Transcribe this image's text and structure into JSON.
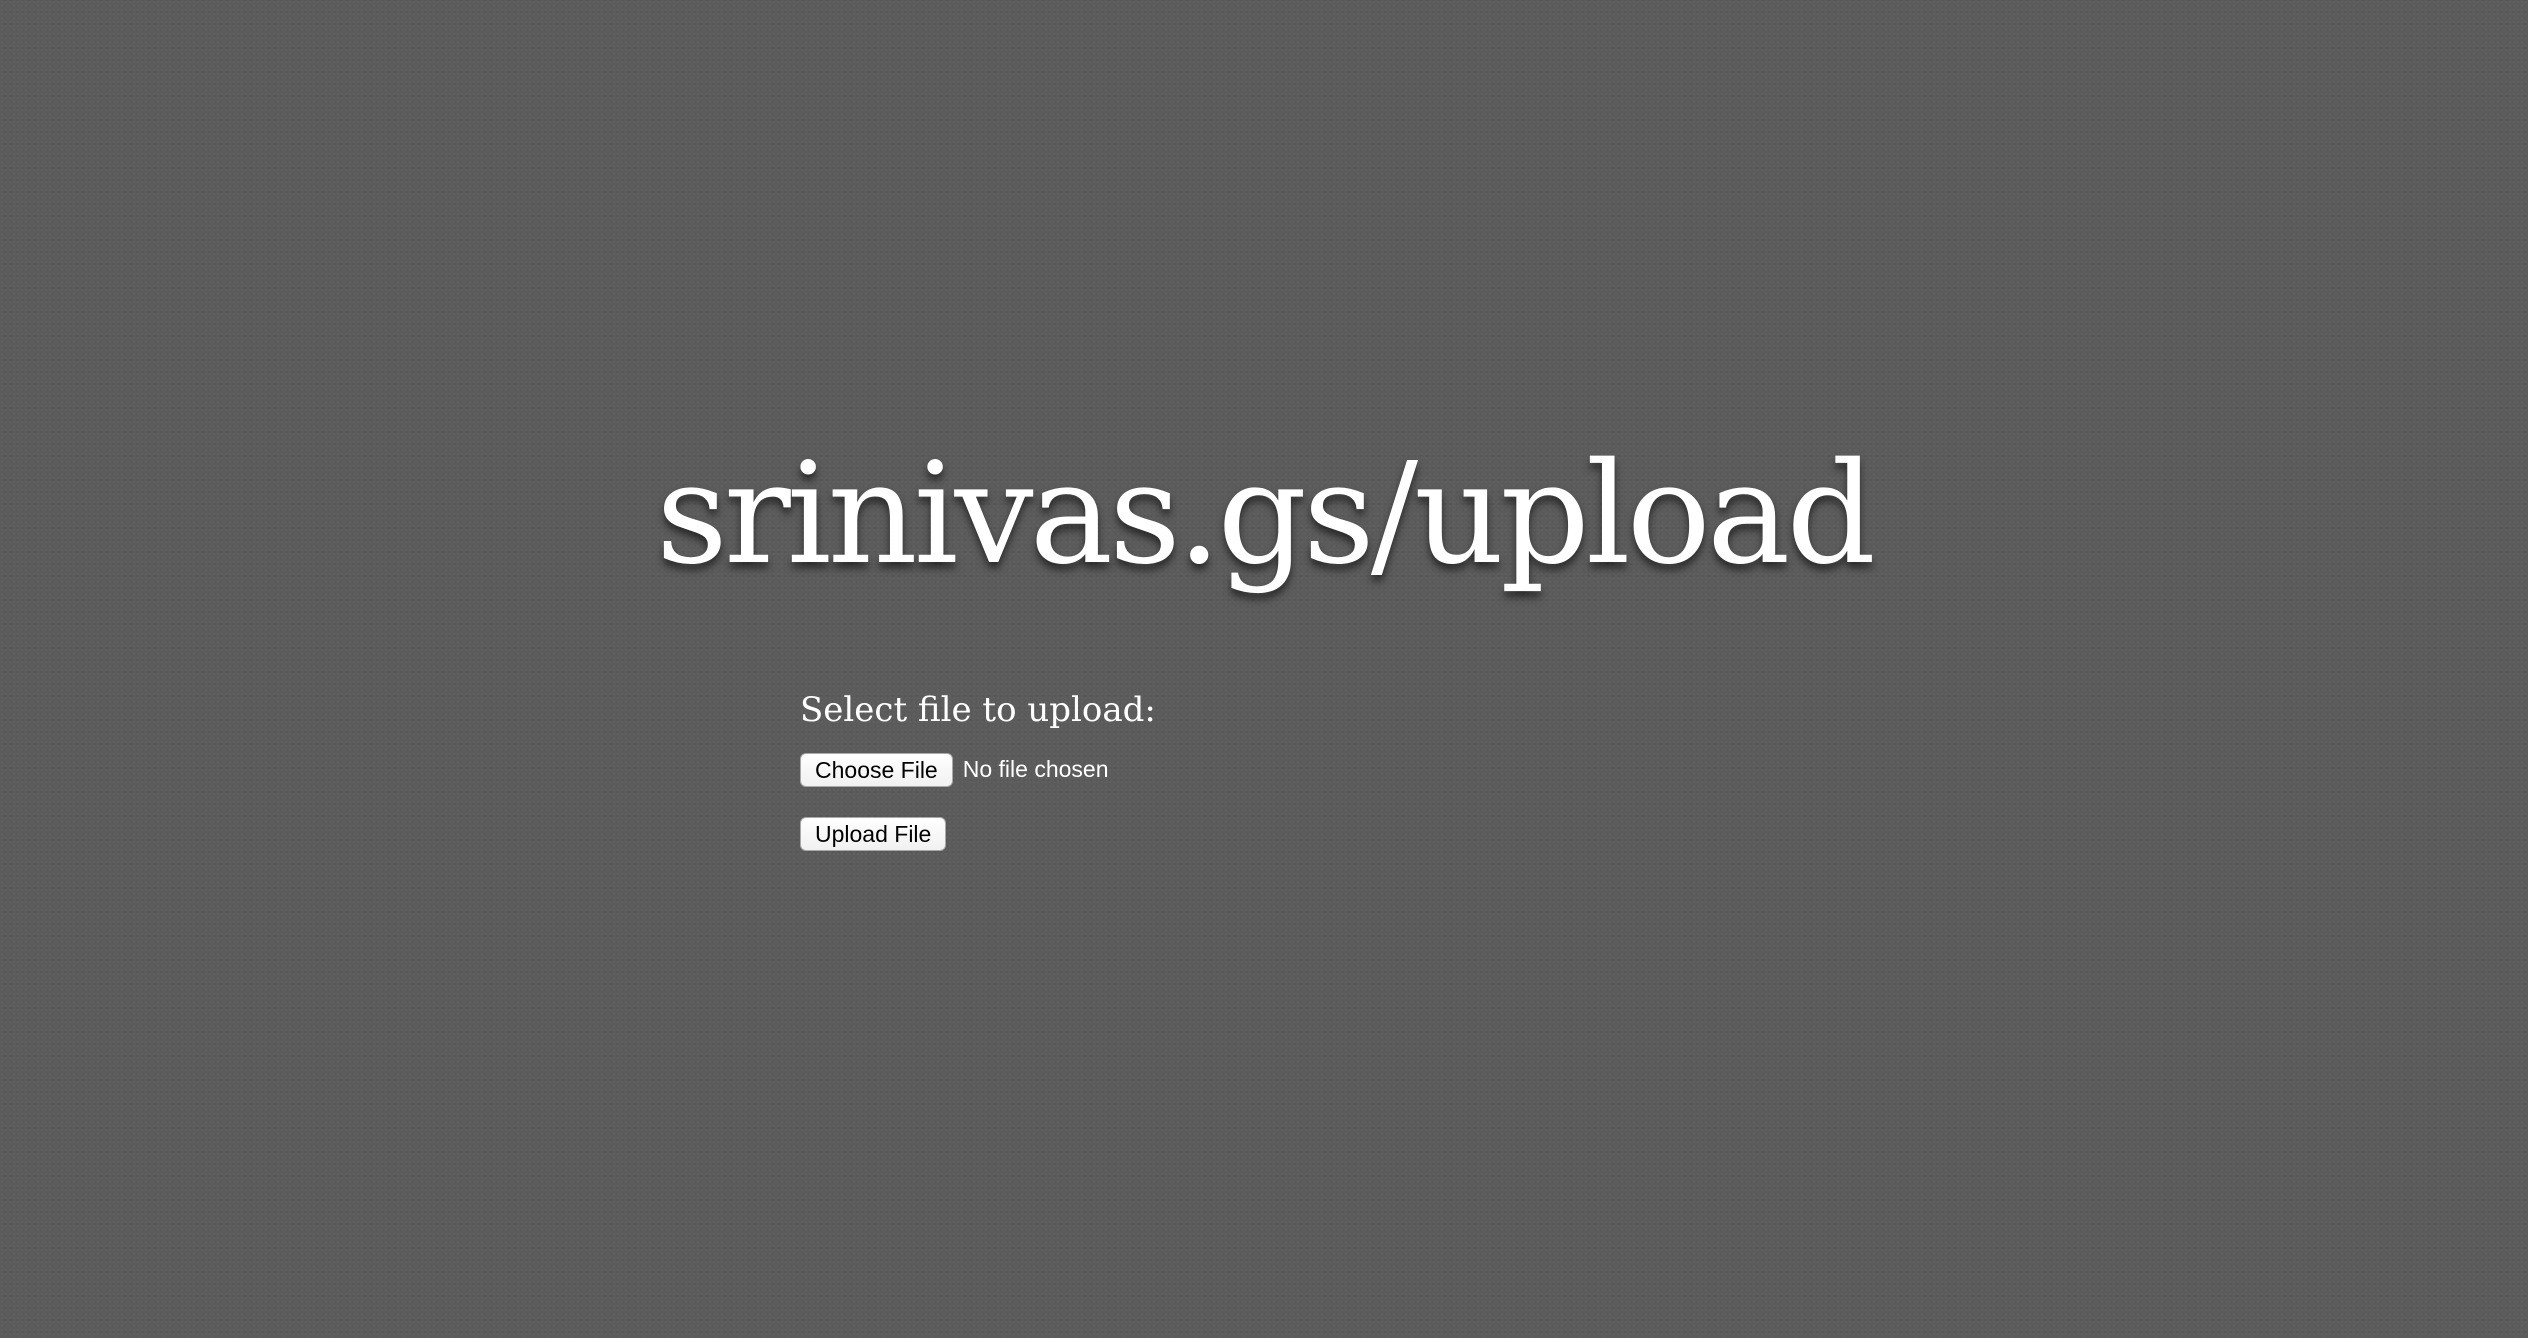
{
  "header": {
    "title": "srinivas.gs/upload"
  },
  "form": {
    "label": "Select file to upload:",
    "choose_file_label": "Choose File",
    "file_status": "No file chosen",
    "upload_label": "Upload File"
  },
  "colors": {
    "background": "#5b5b5b",
    "text": "#ffffff"
  }
}
